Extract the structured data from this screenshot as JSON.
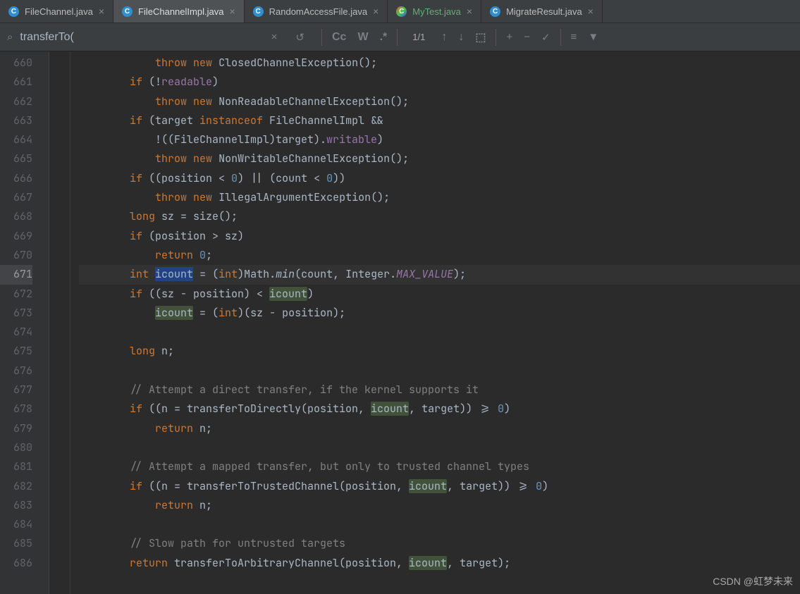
{
  "tabs": [
    {
      "label": "FileChannel.java",
      "active": false,
      "test": false
    },
    {
      "label": "FileChannelImpl.java",
      "active": true,
      "test": false
    },
    {
      "label": "RandomAccessFile.java",
      "active": false,
      "test": false
    },
    {
      "label": "MyTest.java",
      "active": false,
      "test": true
    },
    {
      "label": "MigrateResult.java",
      "active": false,
      "test": false
    }
  ],
  "search": {
    "query": "transferTo(",
    "result_count": "1/1"
  },
  "toolbar_icons": {
    "clear": "×",
    "history": "↺",
    "case": "Cc",
    "word": "W",
    "regex": ".*",
    "prev": "↑",
    "next": "↓",
    "select_all": "⬚",
    "add_sel": "+",
    "remove_sel": "−",
    "check_sel": "✓",
    "filter_list": "≡",
    "filter": "▼"
  },
  "gutter_start": 660,
  "gutter_end": 686,
  "highlight_line": 671,
  "code": [
    {
      "n": 660,
      "tokens": [
        [
          "",
          "            "
        ],
        [
          "kw",
          "throw"
        ],
        [
          "",
          " "
        ],
        [
          "kw",
          "new"
        ],
        [
          "",
          " ClosedChannelException();"
        ]
      ]
    },
    {
      "n": 661,
      "tokens": [
        [
          "",
          "        "
        ],
        [
          "kw",
          "if"
        ],
        [
          "",
          " (!"
        ],
        [
          "field",
          "readable"
        ],
        [
          "",
          ")"
        ]
      ]
    },
    {
      "n": 662,
      "tokens": [
        [
          "",
          "            "
        ],
        [
          "kw",
          "throw"
        ],
        [
          "",
          " "
        ],
        [
          "kw",
          "new"
        ],
        [
          "",
          " NonReadableChannelException();"
        ]
      ]
    },
    {
      "n": 663,
      "tokens": [
        [
          "",
          "        "
        ],
        [
          "kw",
          "if"
        ],
        [
          "",
          " (target "
        ],
        [
          "kw",
          "instanceof"
        ],
        [
          "",
          " FileChannelImpl &&"
        ]
      ]
    },
    {
      "n": 664,
      "tokens": [
        [
          "",
          "            !((FileChannelImpl)target)."
        ],
        [
          "field",
          "writable"
        ],
        [
          "",
          ")"
        ]
      ]
    },
    {
      "n": 665,
      "tokens": [
        [
          "",
          "            "
        ],
        [
          "kw",
          "throw"
        ],
        [
          "",
          " "
        ],
        [
          "kw",
          "new"
        ],
        [
          "",
          " NonWritableChannelException();"
        ]
      ]
    },
    {
      "n": 666,
      "tokens": [
        [
          "",
          "        "
        ],
        [
          "kw",
          "if"
        ],
        [
          "",
          " ((position < "
        ],
        [
          "num",
          "0"
        ],
        [
          "",
          ") || (count < "
        ],
        [
          "num",
          "0"
        ],
        [
          "",
          "))"
        ]
      ]
    },
    {
      "n": 667,
      "tokens": [
        [
          "",
          "            "
        ],
        [
          "kw",
          "throw"
        ],
        [
          "",
          " "
        ],
        [
          "kw",
          "new"
        ],
        [
          "",
          " IllegalArgumentException();"
        ]
      ]
    },
    {
      "n": 668,
      "tokens": [
        [
          "",
          "        "
        ],
        [
          "kw",
          "long"
        ],
        [
          "",
          " sz = size();"
        ]
      ]
    },
    {
      "n": 669,
      "tokens": [
        [
          "",
          "        "
        ],
        [
          "kw",
          "if"
        ],
        [
          "",
          " (position > sz)"
        ]
      ]
    },
    {
      "n": 670,
      "tokens": [
        [
          "",
          "            "
        ],
        [
          "kw",
          "return"
        ],
        [
          "",
          " "
        ],
        [
          "num",
          "0"
        ],
        [
          "",
          ";"
        ]
      ]
    },
    {
      "n": 671,
      "tokens": [
        [
          "",
          "        "
        ],
        [
          "kw",
          "int"
        ],
        [
          "",
          " "
        ],
        [
          "hl-word-cur",
          "icount"
        ],
        [
          "",
          " = ("
        ],
        [
          "kw",
          "int"
        ],
        [
          "",
          ")Math."
        ],
        [
          "italic",
          "min"
        ],
        [
          "",
          "(count, Integer."
        ],
        [
          "static-italic",
          "MAX_VALUE"
        ],
        [
          "",
          ");"
        ]
      ]
    },
    {
      "n": 672,
      "tokens": [
        [
          "",
          "        "
        ],
        [
          "kw",
          "if"
        ],
        [
          "",
          " ((sz - position) < "
        ],
        [
          "hl-word",
          "icount"
        ],
        [
          "",
          ")"
        ]
      ]
    },
    {
      "n": 673,
      "tokens": [
        [
          "",
          "            "
        ],
        [
          "hl-word",
          "icount"
        ],
        [
          "",
          " = ("
        ],
        [
          "kw",
          "int"
        ],
        [
          "",
          ")(sz - position);"
        ]
      ]
    },
    {
      "n": 674,
      "tokens": [
        [
          "",
          ""
        ]
      ]
    },
    {
      "n": 675,
      "tokens": [
        [
          "",
          "        "
        ],
        [
          "kw",
          "long"
        ],
        [
          "",
          " n;"
        ]
      ]
    },
    {
      "n": 676,
      "tokens": [
        [
          "",
          ""
        ]
      ]
    },
    {
      "n": 677,
      "tokens": [
        [
          "",
          "        "
        ],
        [
          "comment",
          "// Attempt a direct transfer, if the kernel supports it"
        ]
      ]
    },
    {
      "n": 678,
      "tokens": [
        [
          "",
          "        "
        ],
        [
          "kw",
          "if"
        ],
        [
          "",
          " ((n = transferToDirectly(position, "
        ],
        [
          "hl-word",
          "icount"
        ],
        [
          "",
          ", target)) >= "
        ],
        [
          "num",
          "0"
        ],
        [
          "",
          ")"
        ]
      ]
    },
    {
      "n": 679,
      "tokens": [
        [
          "",
          "            "
        ],
        [
          "kw",
          "return"
        ],
        [
          "",
          " n;"
        ]
      ]
    },
    {
      "n": 680,
      "tokens": [
        [
          "",
          ""
        ]
      ]
    },
    {
      "n": 681,
      "tokens": [
        [
          "",
          "        "
        ],
        [
          "comment",
          "// Attempt a mapped transfer, but only to trusted channel types"
        ]
      ]
    },
    {
      "n": 682,
      "tokens": [
        [
          "",
          "        "
        ],
        [
          "kw",
          "if"
        ],
        [
          "",
          " ((n = transferToTrustedChannel(position, "
        ],
        [
          "hl-word",
          "icount"
        ],
        [
          "",
          ", target)) >= "
        ],
        [
          "num",
          "0"
        ],
        [
          "",
          ")"
        ]
      ]
    },
    {
      "n": 683,
      "tokens": [
        [
          "",
          "            "
        ],
        [
          "kw",
          "return"
        ],
        [
          "",
          " n;"
        ]
      ]
    },
    {
      "n": 684,
      "tokens": [
        [
          "",
          ""
        ]
      ]
    },
    {
      "n": 685,
      "tokens": [
        [
          "",
          "        "
        ],
        [
          "comment",
          "// Slow path for untrusted targets"
        ]
      ]
    },
    {
      "n": 686,
      "tokens": [
        [
          "",
          "        "
        ],
        [
          "kw",
          "return"
        ],
        [
          "",
          " transferToArbitraryChannel(position, "
        ],
        [
          "hl-word",
          "icount"
        ],
        [
          "",
          ", target);"
        ]
      ]
    }
  ],
  "watermark": "CSDN @虹梦未来"
}
